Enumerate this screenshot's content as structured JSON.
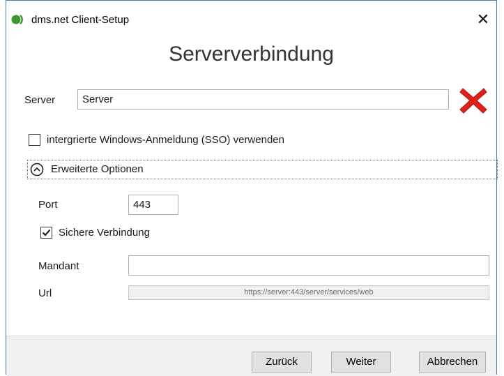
{
  "window": {
    "title": "dms.net Client-Setup",
    "close_glyph": "✕"
  },
  "page": {
    "heading": "Serververbindung"
  },
  "server": {
    "label": "Server",
    "value": "Server",
    "status_icon": "error-x-icon",
    "status_color": "#e0201b"
  },
  "sso": {
    "label": "intergrierte Windows-Anmeldung (SSO) verwenden",
    "checked": false
  },
  "advanced": {
    "label": "Erweiterte Optionen",
    "expanded": true,
    "port": {
      "label": "Port",
      "value": "443"
    },
    "secure": {
      "label": "Sichere Verbindung",
      "checked": true
    },
    "tenant": {
      "label": "Mandant",
      "value": ""
    },
    "url": {
      "label": "Url",
      "value": "https://server:443/server/services/web"
    }
  },
  "buttons": {
    "back": "Zurück",
    "next": "Weiter",
    "cancel": "Abbrechen"
  },
  "colors": {
    "window_border": "#3c7fb1",
    "logo_green": "#3a9a2e",
    "footer_bg": "#f0f0f0"
  }
}
